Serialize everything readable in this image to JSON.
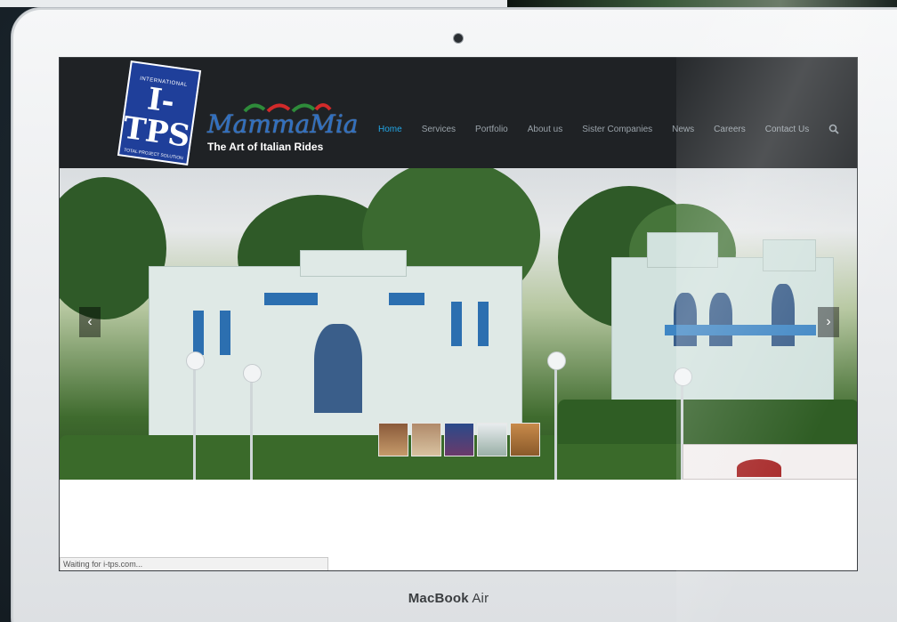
{
  "device": {
    "brand_bold": "MacBook",
    "brand_light": "Air"
  },
  "site": {
    "logo_itps": {
      "top": "INTERNATIONAL",
      "main": "I-TPS",
      "bottom": "TOTAL PROJECT SOLUTION"
    },
    "logo_mamma": {
      "script": "MammaMia",
      "tagline": "The Art of Italian Rides"
    },
    "nav": [
      {
        "label": "Home"
      },
      {
        "label": "Services"
      },
      {
        "label": "Portfolio"
      },
      {
        "label": "About us"
      },
      {
        "label": "Sister Companies"
      },
      {
        "label": "News"
      },
      {
        "label": "Careers"
      },
      {
        "label": "Contact Us"
      }
    ],
    "active_nav": "Home",
    "colors": {
      "header_bg": "#1f2225",
      "nav_text": "#9aa3aa",
      "nav_active": "#22a6e6"
    }
  },
  "slider": {
    "prev_symbol": "‹",
    "next_symbol": "›"
  },
  "status_bar": {
    "text": "Waiting for i-tps.com..."
  }
}
